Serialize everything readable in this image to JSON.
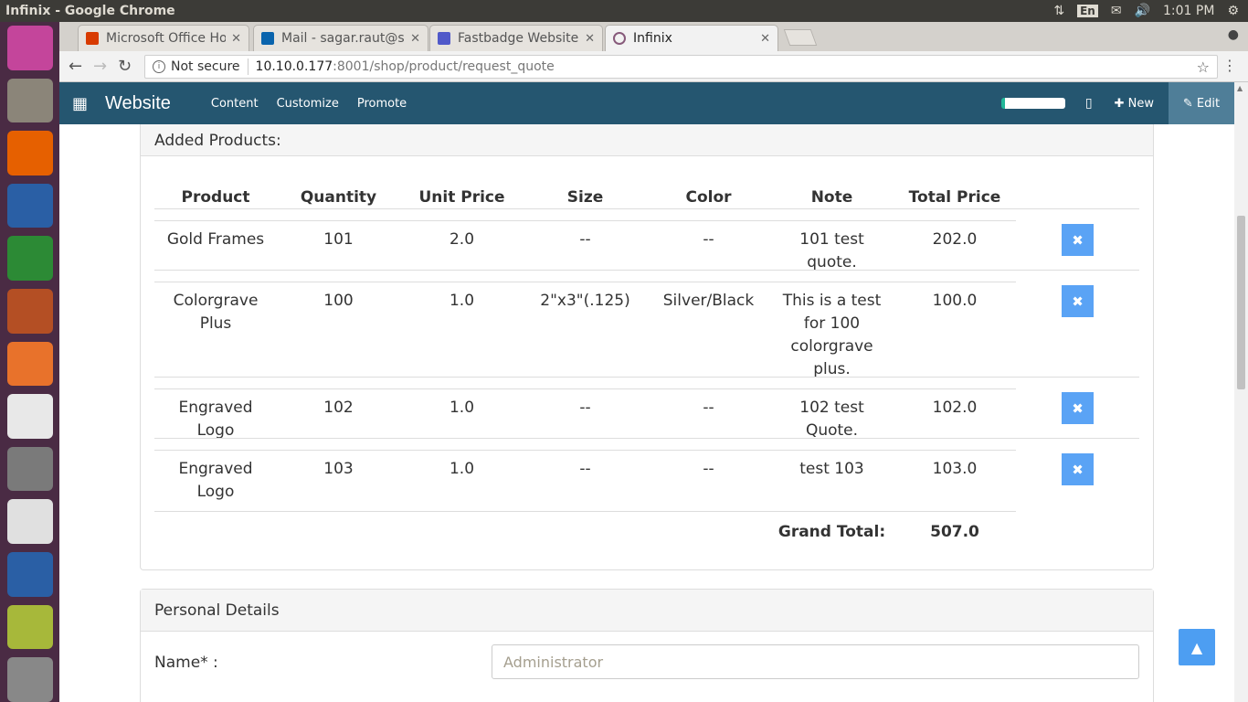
{
  "os_bar": {
    "window_title": "Infinix - Google Chrome",
    "keyboard": "En",
    "time": "1:01 PM"
  },
  "launcher": {
    "apps": [
      {
        "name": "ubuntu-dash-icon",
        "color": "#c4459b"
      },
      {
        "name": "files-icon",
        "color": "#8b8579"
      },
      {
        "name": "firefox-icon",
        "color": "#e66000"
      },
      {
        "name": "writer-icon",
        "color": "#2a5fa5"
      },
      {
        "name": "calc-icon",
        "color": "#2c8a35"
      },
      {
        "name": "impress-icon",
        "color": "#b44f24"
      },
      {
        "name": "software-center-icon",
        "color": "#e8722b"
      },
      {
        "name": "amazon-icon",
        "color": "#e8e8e8"
      },
      {
        "name": "system-settings-icon",
        "color": "#7a7a7a"
      },
      {
        "name": "chrome-icon",
        "color": "#e0e0e0"
      },
      {
        "name": "thunderbird-icon",
        "color": "#2a5fa5"
      },
      {
        "name": "search-app-icon",
        "color": "#a7b83a"
      },
      {
        "name": "trash-icon",
        "color": "#888888"
      }
    ]
  },
  "browser": {
    "tabs": [
      {
        "label": "Microsoft Office Ho",
        "icon_color": "#d83b01",
        "active": false
      },
      {
        "label": "Mail - sagar.raut@s",
        "icon_color": "#0a64ad",
        "active": false
      },
      {
        "label": "Fastbadge Website",
        "icon_color": "#5059c9",
        "active": false
      },
      {
        "label": "Infinix",
        "icon_color": "#875a7b",
        "active": true
      }
    ],
    "url": {
      "security": "Not secure",
      "host": "10.10.0.177",
      "path": ":8001/shop/product/request_quote"
    }
  },
  "odoo_nav": {
    "brand": "Website",
    "menu": [
      "Content",
      "Customize",
      "Promote"
    ],
    "new_label": "New",
    "edit_label": "Edit"
  },
  "added_products": {
    "heading": "Added Products:",
    "columns": [
      "Product",
      "Quantity",
      "Unit Price",
      "Size",
      "Color",
      "Note",
      "Total Price"
    ],
    "rows": [
      {
        "product": "Gold Frames",
        "quantity": "101",
        "unit_price": "2.0",
        "size": "--",
        "color": "--",
        "note": "101 test quote.",
        "total": "202.0"
      },
      {
        "product": "Colorgrave Plus",
        "quantity": "100",
        "unit_price": "1.0",
        "size": "2\"x3\"(.125)",
        "color": "Silver/Black",
        "note": "This is a test for 100 colorgrave plus.",
        "total": "100.0"
      },
      {
        "product": "Engraved Logo",
        "quantity": "102",
        "unit_price": "1.0",
        "size": "--",
        "color": "--",
        "note": "102 test Quote.",
        "total": "102.0"
      },
      {
        "product": "Engraved Logo",
        "quantity": "103",
        "unit_price": "1.0",
        "size": "--",
        "color": "--",
        "note": "test 103",
        "total": "103.0"
      }
    ],
    "grand_total_label": "Grand Total:",
    "grand_total_value": "507.0"
  },
  "personal_details": {
    "heading": "Personal Details",
    "name_label": "Name* :",
    "name_placeholder": "Administrator"
  }
}
